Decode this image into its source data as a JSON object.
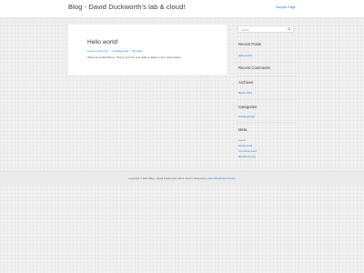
{
  "header": {
    "site_title": "Blog - David Duckworth's lab & cloud!",
    "nav_link": "Sample Page"
  },
  "post": {
    "title": "Hello world!",
    "meta": {
      "comment_link": "Leave a Comment",
      "separator1": "/",
      "category": "Uncategorized",
      "separator2": "/",
      "author": "By david"
    },
    "excerpt": "Welcome to WordPress. This is your first post. Edit or delete it, then start writing!"
  },
  "sidebar": {
    "search": {
      "placeholder": "Search ..."
    },
    "recent_posts": {
      "title": "Recent Posts",
      "items": [
        "Hello world!"
      ]
    },
    "recent_comments": {
      "title": "Recent Comments"
    },
    "archives": {
      "title": "Archives",
      "items": [
        "March 2021"
      ]
    },
    "categories": {
      "title": "Categories",
      "items": [
        "Uncategorized"
      ]
    },
    "meta": {
      "title": "Meta",
      "items": [
        "Log in",
        "Entries feed",
        "Comments feed",
        "WordPress.org"
      ]
    }
  },
  "footer": {
    "copyright": "Copyright © 2021 Blog - David Duckworth's lab & cloud! | Powered by",
    "theme_link": "Astra WordPress Theme"
  },
  "colors": {
    "link": "#2f7bd6",
    "heading": "#3a3a3a",
    "background": "#f1f1f1"
  }
}
